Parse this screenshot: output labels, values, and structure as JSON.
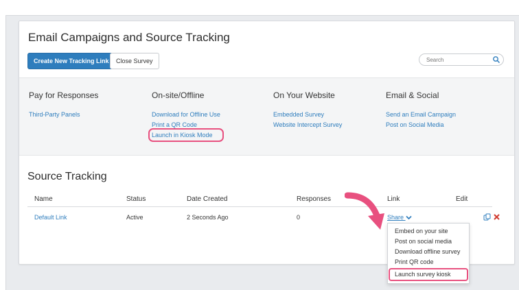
{
  "page": {
    "title": "Email Campaigns and Source Tracking",
    "create_button": "Create New Tracking Link",
    "close_button": "Close Survey",
    "search_placeholder": "Search"
  },
  "methods": [
    {
      "heading": "Pay for Responses",
      "links": [
        "Third-Party Panels"
      ]
    },
    {
      "heading": "On-site/Offline",
      "links": [
        "Download for Offline Use",
        "Print a QR Code",
        "Launch in Kiosk Mode"
      ]
    },
    {
      "heading": "On Your Website",
      "links": [
        "Embedded Survey",
        "Website Intercept Survey"
      ]
    },
    {
      "heading": "Email & Social",
      "links": [
        "Send an Email Campaign",
        "Post on Social Media"
      ]
    }
  ],
  "source_tracking": {
    "title": "Source Tracking",
    "columns": [
      "Name",
      "Status",
      "Date Created",
      "Responses",
      "Link",
      "Edit"
    ],
    "rows": [
      {
        "name": "Default Link",
        "status": "Active",
        "date_created": "2 Seconds Ago",
        "responses": "0",
        "link": "Share"
      }
    ]
  },
  "share_menu": [
    "Embed on your site",
    "Post on social media",
    "Download offline survey",
    "Print QR code",
    "Launch survey kiosk"
  ],
  "colors": {
    "accent": "#2e7dbd",
    "highlight": "#e8507f"
  },
  "icons": [
    "search-icon",
    "chevron-down-icon",
    "copy-icon",
    "delete-icon",
    "pointer-arrow-icon"
  ]
}
